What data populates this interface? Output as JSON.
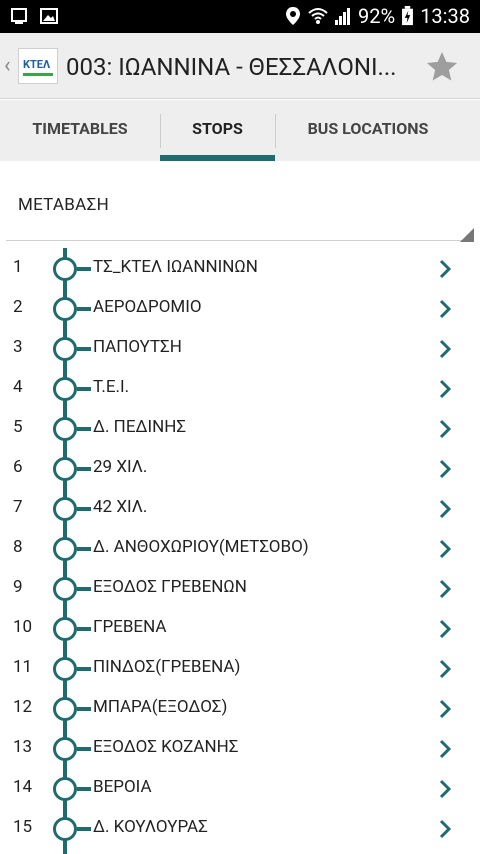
{
  "status_bar": {
    "battery": "92%",
    "time": "13:38",
    "icons": [
      "window-icon",
      "image-icon",
      "location-icon",
      "wifi-icon",
      "signal-icon",
      "battery-icon"
    ]
  },
  "app_bar": {
    "back_icon": "back-icon",
    "logo_text": "ΚΤΕΛ",
    "title": "003: ΙΩΑΝΝΙΝΑ - ΘΕΣΣΑΛΟΝΙ...",
    "favorite_icon": "star-icon"
  },
  "tabs": [
    {
      "label": "TIMETABLES",
      "active": false
    },
    {
      "label": "STOPS",
      "active": true
    },
    {
      "label": "BUS LOCATIONS",
      "active": false
    }
  ],
  "direction": {
    "selected": "ΜΕΤΑΒΑΣΗ"
  },
  "stops": [
    {
      "num": "1",
      "name": "ΤΣ_ΚΤΕΛ ΙΩΑΝΝΙΝΩΝ"
    },
    {
      "num": "2",
      "name": "ΑΕΡΟΔΡΟΜΙΟ"
    },
    {
      "num": "3",
      "name": "ΠΑΠΟΥΤΣΗ"
    },
    {
      "num": "4",
      "name": "Τ.Ε.Ι."
    },
    {
      "num": "5",
      "name": "Δ. ΠΕΔΙΝΗΣ"
    },
    {
      "num": "6",
      "name": "29 ΧΙΛ."
    },
    {
      "num": "7",
      "name": "42 ΧΙΛ."
    },
    {
      "num": "8",
      "name": "Δ. ΑΝΘΟΧΩΡΙΟΥ(ΜΕΤΣΟΒΟ)"
    },
    {
      "num": "9",
      "name": "ΕΞΟΔΟΣ ΓΡΕΒΕΝΩΝ"
    },
    {
      "num": "10",
      "name": "ΓΡΕΒΕΝΑ"
    },
    {
      "num": "11",
      "name": "ΠΙΝΔΟΣ(ΓΡΕΒΕΝΑ)"
    },
    {
      "num": "12",
      "name": "ΜΠΑΡΑ(ΕΞΟΔΟΣ)"
    },
    {
      "num": "13",
      "name": "ΕΞΟΔΟΣ ΚΟΖΑΝΗΣ"
    },
    {
      "num": "14",
      "name": "ΒΕΡΟΙΑ"
    },
    {
      "num": "15",
      "name": "Δ. ΚΟΥΛΟΥΡΑΣ"
    }
  ],
  "colors": {
    "accent": "#1f6b6e",
    "chevron": "#1f6b6e",
    "app_bar_bg": "#eeeeee",
    "status_bar_bg": "#000000"
  }
}
